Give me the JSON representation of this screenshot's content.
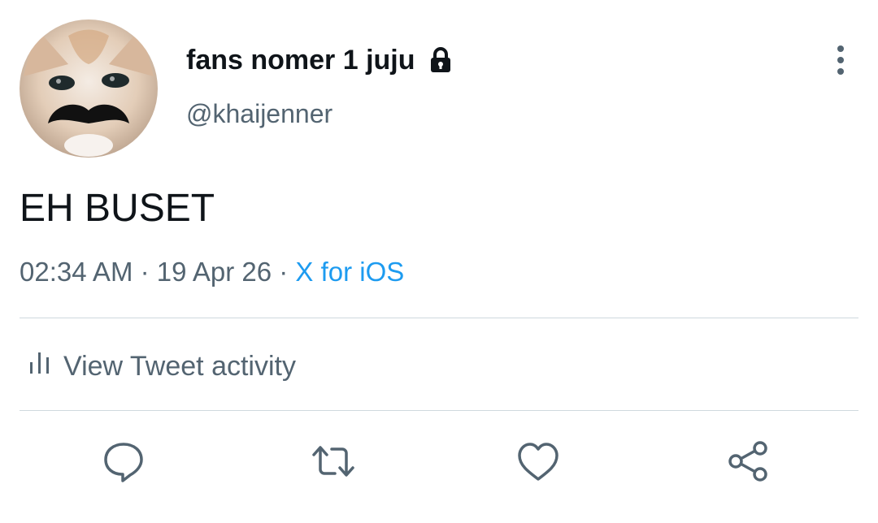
{
  "tweet": {
    "display_name": "fans nomer 1 juju",
    "handle": "@khaijenner",
    "text": "EH BUSET",
    "time": "02:34 AM",
    "separator1": "·",
    "date": "19 Apr 26",
    "separator2": "·",
    "source": "X for iOS",
    "activity_label": "View Tweet activity",
    "protected": true
  },
  "colors": {
    "primary_text": "#0f1419",
    "secondary_text": "#536471",
    "link": "#1d9bf0",
    "divider": "#cfd9de"
  },
  "icons": [
    "lock-icon",
    "more-options-icon",
    "activity-chart-icon",
    "reply-icon",
    "retweet-icon",
    "like-icon",
    "share-icon"
  ]
}
